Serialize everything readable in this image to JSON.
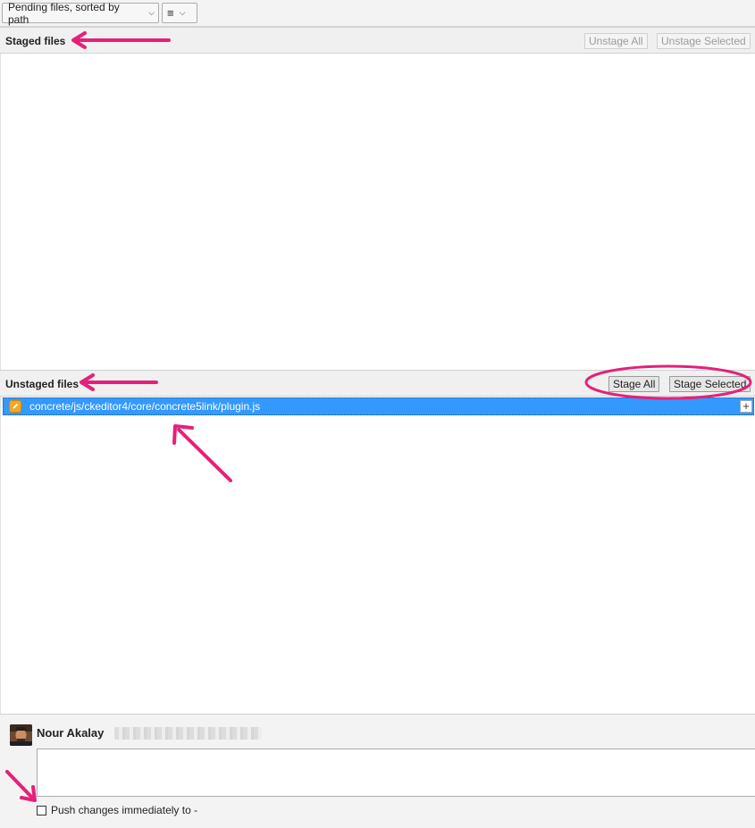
{
  "toolbar": {
    "sort_dropdown": "Pending files, sorted by path",
    "view_dropdown_icon": "list-lines-icon"
  },
  "staged": {
    "title": "Staged files",
    "unstage_all": "Unstage All",
    "unstage_selected": "Unstage Selected",
    "files": []
  },
  "unstaged": {
    "title": "Unstaged files",
    "stage_all": "Stage All",
    "stage_selected": "Stage Selected",
    "files": [
      {
        "path": "concrete/js/ckeditor4/core/concrete5link/plugin.js",
        "status_icon": "modified-pencil-icon",
        "selected": true
      }
    ]
  },
  "commit": {
    "author_name": "Nour Akalay",
    "message": "",
    "push_label": "Push changes immediately to -",
    "push_checked": false
  },
  "colors": {
    "selection": "#3399ff",
    "annotation": "#e6207a",
    "modified_icon": "#f5a623"
  }
}
